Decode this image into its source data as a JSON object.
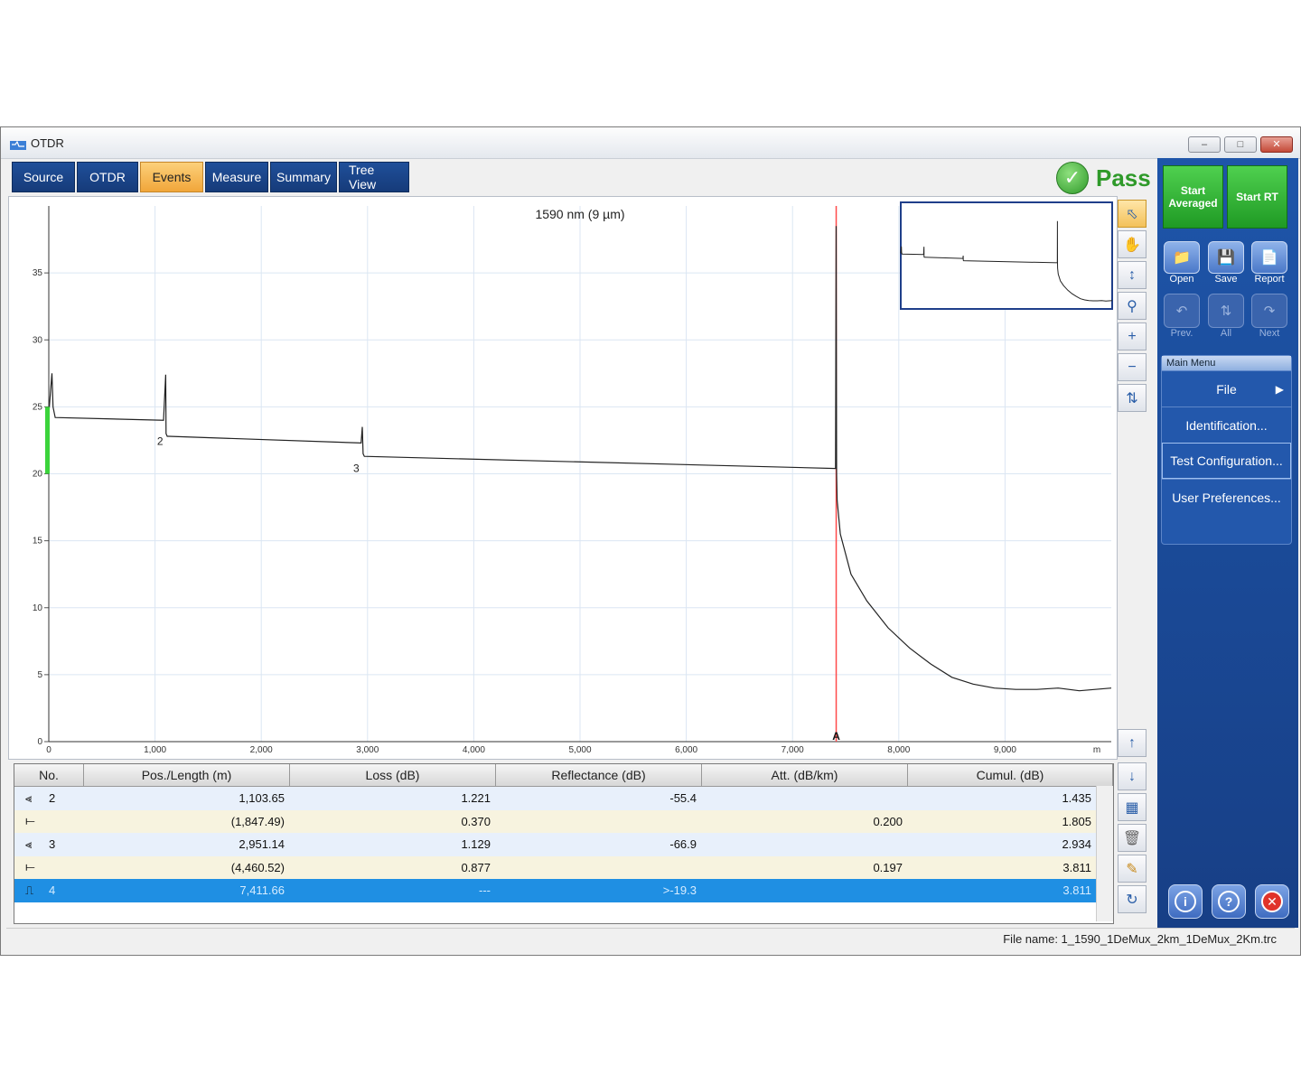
{
  "window": {
    "title": "OTDR"
  },
  "tabs": [
    {
      "label": "Source"
    },
    {
      "label": "OTDR"
    },
    {
      "label": "Events",
      "active": true
    },
    {
      "label": "Measure"
    },
    {
      "label": "Summary"
    },
    {
      "label": "Tree View"
    }
  ],
  "status": {
    "result": "Pass",
    "color": "#2f9a2a"
  },
  "chart_data": {
    "type": "line",
    "title": "1590 nm (9 µm)",
    "xlabel": "m",
    "ylabel": "",
    "xlim": [
      0,
      10000
    ],
    "ylim": [
      0,
      40
    ],
    "x_ticks": [
      "0",
      "1,000",
      "2,000",
      "3,000",
      "4,000",
      "5,000",
      "6,000",
      "7,000",
      "8,000",
      "9,000",
      "m"
    ],
    "y_ticks": [
      "0",
      "5",
      "10",
      "15",
      "20",
      "25",
      "30",
      "35"
    ],
    "grid": true,
    "series": [
      {
        "x": [
          0,
          30,
          40,
          60,
          1080,
          1100,
          1104,
          1115,
          1130,
          2940,
          2951,
          2958,
          2970,
          7405,
          7411,
          7415,
          7420,
          7450,
          7550,
          7700,
          7900,
          8100,
          8300,
          8500,
          8700,
          8900,
          9100,
          9300,
          9500,
          9700,
          10000
        ],
        "y": [
          24.5,
          27.5,
          25,
          24.2,
          24.0,
          27.4,
          23.0,
          22.8,
          22.8,
          22.3,
          23.5,
          21.5,
          21.3,
          20.4,
          38.5,
          20.0,
          18,
          15.5,
          12.5,
          10.5,
          8.5,
          7,
          5.8,
          4.8,
          4.3,
          4.0,
          3.9,
          3.9,
          4.0,
          3.8,
          4.0
        ]
      }
    ],
    "markers": [
      {
        "label": "2",
        "x": 1104
      },
      {
        "label": "3",
        "x": 2951
      },
      {
        "label": "A",
        "x": 7411
      }
    ],
    "cursor_x": 7411
  },
  "toolbar_right": {
    "start_averaged": "Start Averaged",
    "start_rt": "Start RT",
    "open": "Open",
    "save": "Save",
    "report": "Report",
    "prev": "Prev.",
    "all": "All",
    "next": "Next"
  },
  "main_menu": {
    "title": "Main Menu",
    "items": [
      "File",
      "Identification...",
      "Test Configuration...",
      "User Preferences..."
    ]
  },
  "table": {
    "headers": [
      "No.",
      "Pos./Length (m)",
      "Loss (dB)",
      "Reflectance (dB)",
      "Att. (dB/km)",
      "Cumul. (dB)"
    ],
    "rows": [
      {
        "icon": "reflective-event-icon",
        "no": "2",
        "pos": "1,103.65",
        "loss": "1.221",
        "refl": "-55.4",
        "att": "",
        "cumul": "1.435"
      },
      {
        "icon": "span-icon",
        "no": "",
        "pos": "(1,847.49)",
        "loss": "0.370",
        "refl": "",
        "att": "0.200",
        "cumul": "1.805"
      },
      {
        "icon": "reflective-event-icon",
        "no": "3",
        "pos": "2,951.14",
        "loss": "1.129",
        "refl": "-66.9",
        "att": "",
        "cumul": "2.934"
      },
      {
        "icon": "span-icon",
        "no": "",
        "pos": "(4,460.52)",
        "loss": "0.877",
        "refl": "",
        "att": "0.197",
        "cumul": "3.811"
      },
      {
        "icon": "fiber-end-icon",
        "no": "4",
        "pos": "7,411.66",
        "loss": "---",
        "refl": ">-19.3",
        "att": "",
        "cumul": "3.811",
        "selected": true
      }
    ]
  },
  "status_bar": {
    "file_name": "File name: 1_1590_1DeMux_2km_1DeMux_2Km.trc"
  }
}
